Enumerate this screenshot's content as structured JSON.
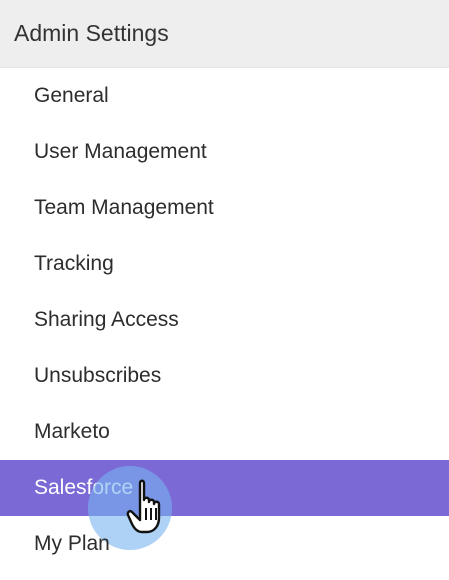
{
  "sidebar": {
    "title": "Admin Settings",
    "items": [
      {
        "label": "General"
      },
      {
        "label": "User Management"
      },
      {
        "label": "Team Management"
      },
      {
        "label": "Tracking"
      },
      {
        "label": "Sharing Access"
      },
      {
        "label": "Unsubscribes"
      },
      {
        "label": "Marketo"
      },
      {
        "label": "Salesforce",
        "active": true
      },
      {
        "label": "My Plan"
      }
    ]
  },
  "colors": {
    "active_background": "#7b6ad6",
    "header_background": "#eeeeee",
    "click_ripple": "#78b4f0"
  },
  "cursor": {
    "icon": "hand-pointer-icon"
  }
}
